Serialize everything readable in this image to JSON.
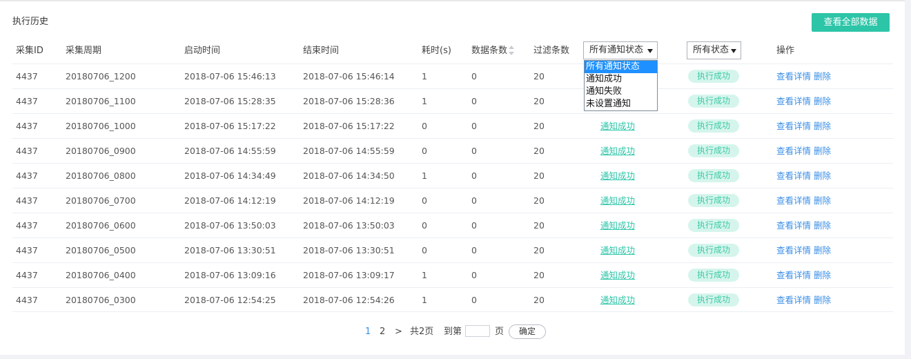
{
  "header": {
    "title": "执行历史",
    "view_all_label": "查看全部数据"
  },
  "columns": {
    "id": "采集ID",
    "period": "采集周期",
    "start": "启动时间",
    "end": "结束时间",
    "duration": "耗时(s)",
    "data_count": "数据条数",
    "filter_count": "过滤条数",
    "operation": "操作"
  },
  "notify_filter": {
    "selected": "所有通知状态",
    "options": [
      "所有通知状态",
      "通知成功",
      "通知失败",
      "未设置通知"
    ]
  },
  "status_filter": {
    "selected": "所有状态"
  },
  "actions": {
    "detail": "查看详情",
    "delete": "删除"
  },
  "rows": [
    {
      "id": "4437",
      "period": "20180706_1200",
      "start": "2018-07-06 15:46:13",
      "end": "2018-07-06 15:46:14",
      "duration": "1",
      "data_count": "0",
      "filter_count": "20",
      "notify": "",
      "status": "执行成功"
    },
    {
      "id": "4437",
      "period": "20180706_1100",
      "start": "2018-07-06 15:28:35",
      "end": "2018-07-06 15:28:36",
      "duration": "1",
      "data_count": "0",
      "filter_count": "20",
      "notify": "",
      "status": "执行成功"
    },
    {
      "id": "4437",
      "period": "20180706_1000",
      "start": "2018-07-06 15:17:22",
      "end": "2018-07-06 15:17:22",
      "duration": "0",
      "data_count": "0",
      "filter_count": "20",
      "notify": "通知成功",
      "status": "执行成功"
    },
    {
      "id": "4437",
      "period": "20180706_0900",
      "start": "2018-07-06 14:55:59",
      "end": "2018-07-06 14:55:59",
      "duration": "0",
      "data_count": "0",
      "filter_count": "20",
      "notify": "通知成功",
      "status": "执行成功"
    },
    {
      "id": "4437",
      "period": "20180706_0800",
      "start": "2018-07-06 14:34:49",
      "end": "2018-07-06 14:34:50",
      "duration": "1",
      "data_count": "0",
      "filter_count": "20",
      "notify": "通知成功",
      "status": "执行成功"
    },
    {
      "id": "4437",
      "period": "20180706_0700",
      "start": "2018-07-06 14:12:19",
      "end": "2018-07-06 14:12:19",
      "duration": "0",
      "data_count": "0",
      "filter_count": "20",
      "notify": "通知成功",
      "status": "执行成功"
    },
    {
      "id": "4437",
      "period": "20180706_0600",
      "start": "2018-07-06 13:50:03",
      "end": "2018-07-06 13:50:03",
      "duration": "0",
      "data_count": "0",
      "filter_count": "20",
      "notify": "通知成功",
      "status": "执行成功"
    },
    {
      "id": "4437",
      "period": "20180706_0500",
      "start": "2018-07-06 13:30:51",
      "end": "2018-07-06 13:30:51",
      "duration": "0",
      "data_count": "0",
      "filter_count": "20",
      "notify": "通知成功",
      "status": "执行成功"
    },
    {
      "id": "4437",
      "period": "20180706_0400",
      "start": "2018-07-06 13:09:16",
      "end": "2018-07-06 13:09:17",
      "duration": "1",
      "data_count": "0",
      "filter_count": "20",
      "notify": "通知成功",
      "status": "执行成功"
    },
    {
      "id": "4437",
      "period": "20180706_0300",
      "start": "2018-07-06 12:54:25",
      "end": "2018-07-06 12:54:26",
      "duration": "1",
      "data_count": "0",
      "filter_count": "20",
      "notify": "通知成功",
      "status": "执行成功"
    }
  ],
  "pagination": {
    "pages": [
      "1",
      "2"
    ],
    "current": "1",
    "next": ">",
    "total": "共2页",
    "goto_prefix": "到第",
    "goto_suffix": "页",
    "confirm": "确定"
  },
  "colors": {
    "accent": "#2dc5a8",
    "link": "#3a8ee6",
    "badge_bg": "#d5f5ec",
    "dropdown_selected": "#1e90ff"
  }
}
